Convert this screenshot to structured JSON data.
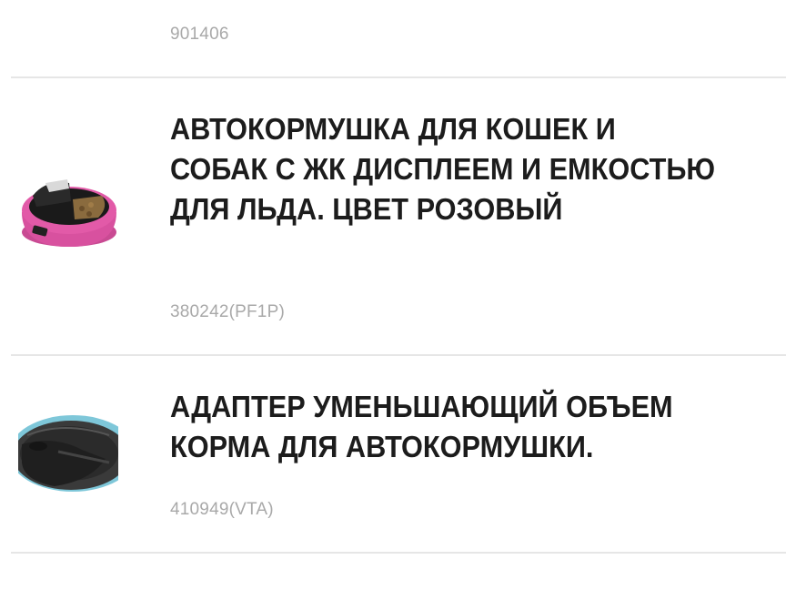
{
  "products": [
    {
      "sku": "901406"
    },
    {
      "title": "АВТОКОРМУШКА ДЛЯ КОШЕК И СОБАК С ЖК ДИСПЛЕЕМ И ЕМКОСТЬЮ ДЛЯ ЛЬДА. ЦВЕТ РОЗОВЫЙ",
      "sku": "380242(PF1P)",
      "image": "pink-pet-feeder-image"
    },
    {
      "title": "АДАПТЕР УМЕНЬШАЮЩИЙ ОБЪЕМ КОРМА ДЛЯ АВТОКОРМУШКИ.",
      "sku": "410949(VTA)",
      "image": "feeder-adapter-image"
    }
  ],
  "colors": {
    "title_text": "#1c1c1c",
    "sku_text": "#a9a9a9",
    "divider": "#e6e6e6",
    "feeder_pink": "#e25aa8"
  }
}
